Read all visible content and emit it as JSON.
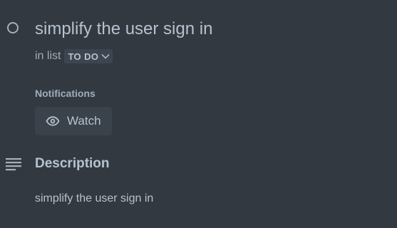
{
  "card": {
    "title": "simplify the user sign in",
    "list_prefix": "in list",
    "list_name": "TO DO"
  },
  "notifications": {
    "heading": "Notifications",
    "watch_label": "Watch"
  },
  "description": {
    "heading": "Description",
    "text": "simplify the user sign in"
  },
  "colors": {
    "background": "#323940",
    "text": "#b6c2cf",
    "button_bg": "#3a424b"
  },
  "icons": {
    "complete": "circle-outline-icon",
    "list_dropdown": "chevron-down-icon",
    "watch": "eye-icon",
    "description": "description-lines-icon"
  }
}
